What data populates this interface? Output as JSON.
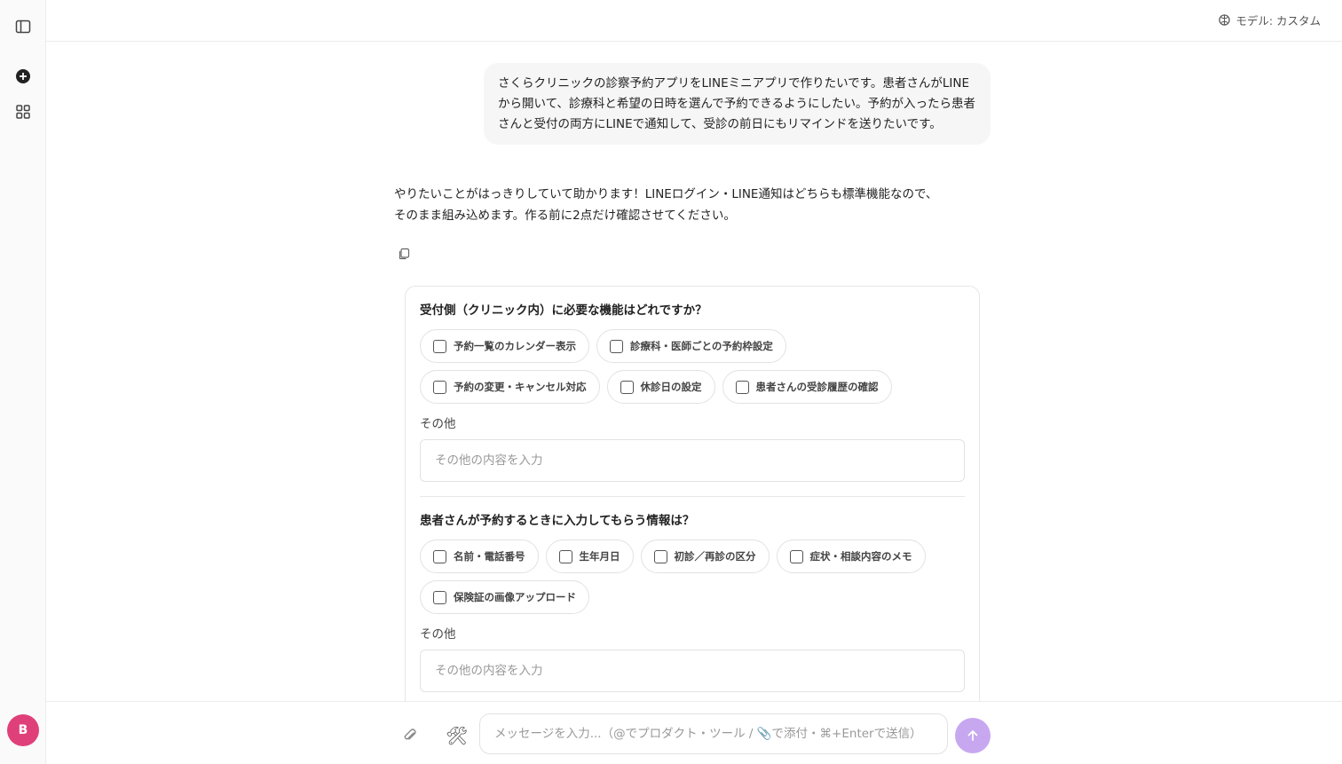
{
  "sidebar": {
    "avatar_initial": "B"
  },
  "topbar": {
    "model_label": "モデル: カスタム"
  },
  "chat": {
    "user_message": "さくらクリニックの診察予約アプリをLINEミニアプリで作りたいです。患者さんがLINEから開いて、診療科と希望の日時を選んで予約できるようにしたい。予約が入ったら患者さんと受付の両方にLINEで通知して、受診の前日にもリマインドを送りたいです。",
    "assistant_message": "やりたいことがはっきりしていて助かります！LINEログイン・LINE通知はどちらも標準機能なので、そのまま組み込めます。作る前に2点だけ確認させてください。"
  },
  "form": {
    "q1": {
      "title": "受付側（クリニック内）に必要な機能はどれですか？",
      "options": [
        "予約一覧のカレンダー表示",
        "診療科・医師ごとの予約枠設定",
        "予約の変更・キャンセル対応",
        "休診日の設定",
        "患者さんの受診履歴の確認"
      ],
      "other_label": "その他",
      "other_placeholder": "その他の内容を入力"
    },
    "q2": {
      "title": "患者さんが予約するときに入力してもらう情報は？",
      "options": [
        "名前・電話番号",
        "生年月日",
        "初診／再診の区分",
        "症状・相談内容のメモ",
        "保険証の画像アップロード"
      ],
      "other_label": "その他",
      "other_placeholder": "その他の内容を入力"
    }
  },
  "composer": {
    "placeholder": "メッセージを入力...（@でプロダクト・ツール / 📎で添付・⌘+Enterで送信）",
    "tools_icon": "🛠"
  },
  "colors": {
    "avatar": "#e0407a",
    "send_button": "#c7a8f0"
  }
}
